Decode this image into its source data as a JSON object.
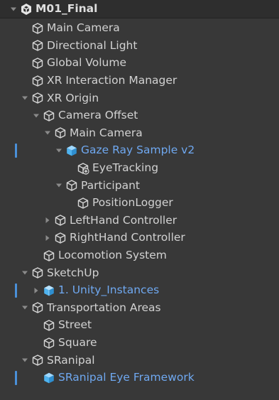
{
  "hierarchy": {
    "items": [
      {
        "label": "M01_Final",
        "depth": 0,
        "expand": "expanded",
        "icon": "unity-scene-icon",
        "kind": "scene",
        "modified": false
      },
      {
        "label": "Main Camera",
        "depth": 1,
        "expand": "none",
        "icon": "gameobject-icon",
        "kind": "object",
        "modified": false
      },
      {
        "label": "Directional Light",
        "depth": 1,
        "expand": "none",
        "icon": "gameobject-icon",
        "kind": "object",
        "modified": false
      },
      {
        "label": "Global Volume",
        "depth": 1,
        "expand": "none",
        "icon": "gameobject-icon",
        "kind": "object",
        "modified": false
      },
      {
        "label": "XR Interaction Manager",
        "depth": 1,
        "expand": "none",
        "icon": "gameobject-icon",
        "kind": "object",
        "modified": false
      },
      {
        "label": "XR Origin",
        "depth": 1,
        "expand": "expanded",
        "icon": "gameobject-icon",
        "kind": "object",
        "modified": false
      },
      {
        "label": "Camera Offset",
        "depth": 2,
        "expand": "expanded",
        "icon": "gameobject-icon",
        "kind": "object",
        "modified": false
      },
      {
        "label": "Main Camera",
        "depth": 3,
        "expand": "expanded",
        "icon": "gameobject-icon",
        "kind": "object",
        "modified": false
      },
      {
        "label": "Gaze Ray Sample v2",
        "depth": 4,
        "expand": "expanded",
        "icon": "prefab-icon",
        "kind": "prefab",
        "modified": true
      },
      {
        "label": "EyeTracking",
        "depth": 5,
        "expand": "none",
        "icon": "gameobject-added-icon",
        "kind": "object",
        "modified": false
      },
      {
        "label": "Participant",
        "depth": 4,
        "expand": "expanded",
        "icon": "gameobject-icon",
        "kind": "object",
        "modified": false
      },
      {
        "label": "PositionLogger",
        "depth": 5,
        "expand": "none",
        "icon": "gameobject-icon",
        "kind": "object",
        "modified": false
      },
      {
        "label": "LeftHand Controller",
        "depth": 3,
        "expand": "collapsed",
        "icon": "gameobject-icon",
        "kind": "object",
        "modified": false
      },
      {
        "label": "RightHand Controller",
        "depth": 3,
        "expand": "collapsed",
        "icon": "gameobject-icon",
        "kind": "object",
        "modified": false
      },
      {
        "label": "Locomotion System",
        "depth": 2,
        "expand": "none",
        "icon": "gameobject-icon",
        "kind": "object",
        "modified": false
      },
      {
        "label": "SketchUp",
        "depth": 1,
        "expand": "expanded",
        "icon": "gameobject-icon",
        "kind": "object",
        "modified": false
      },
      {
        "label": "1. Unity_Instances",
        "depth": 2,
        "expand": "collapsed",
        "icon": "prefab-model-icon",
        "kind": "prefab",
        "modified": true
      },
      {
        "label": "Transportation Areas",
        "depth": 1,
        "expand": "expanded",
        "icon": "gameobject-icon",
        "kind": "object",
        "modified": false
      },
      {
        "label": "Street",
        "depth": 2,
        "expand": "none",
        "icon": "gameobject-icon",
        "kind": "object",
        "modified": false
      },
      {
        "label": "Square",
        "depth": 2,
        "expand": "none",
        "icon": "gameobject-icon",
        "kind": "object",
        "modified": false
      },
      {
        "label": "SRanipal",
        "depth": 1,
        "expand": "expanded",
        "icon": "gameobject-icon",
        "kind": "object",
        "modified": false
      },
      {
        "label": "SRanipal Eye Framework",
        "depth": 2,
        "expand": "none",
        "icon": "prefab-icon",
        "kind": "prefab",
        "modified": true
      }
    ]
  },
  "colors": {
    "background": "#383838",
    "scene_row": "#2e2e2e",
    "text": "#d2d2d2",
    "prefab_text": "#6fa8f0",
    "prefab_icon": "#4fb3ef",
    "modified_marker": "#4a90d9"
  }
}
